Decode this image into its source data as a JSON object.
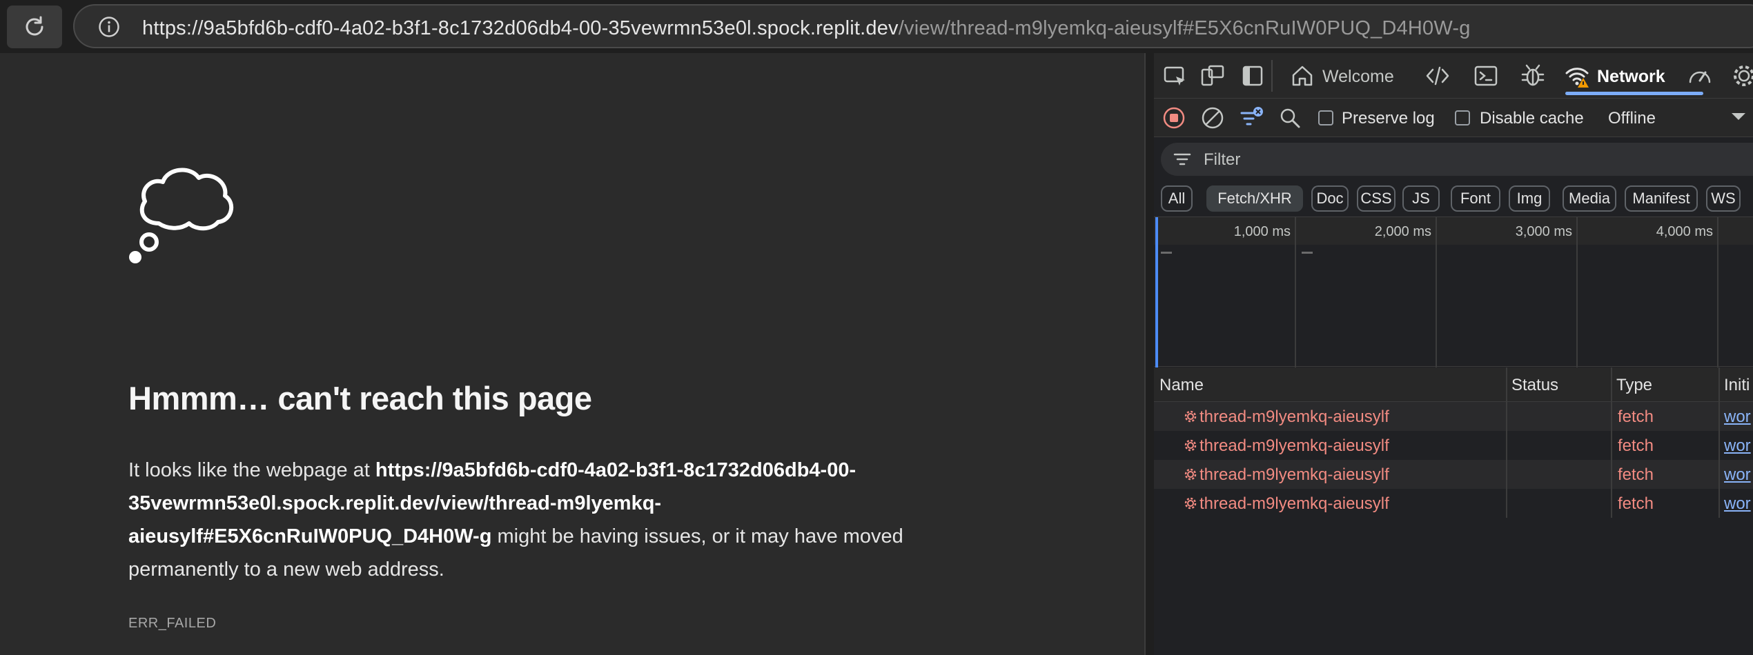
{
  "browser": {
    "url_host": "https://9a5bfd6b-cdf0-4a02-b3f1-8c1732d06db4-00-35vewrmn53e0l.spock.replit.dev",
    "url_path": "/view/thread-m9lyemkq-aieusylf#E5X6cnRuIW0PUQ_D4H0W-g",
    "icons": {
      "reload": "reload-icon",
      "info": "info-icon"
    }
  },
  "error_page": {
    "icon": "thought-cloud-icon",
    "title": "Hmmm… can't reach this page",
    "body_prefix": "It looks like the webpage at ",
    "body_url_line1": "https://9a5bfd6b-cdf0-4a02-b3f1-8c1732d06db4-00-",
    "body_url_line2": "35vewrmn53e0l.spock.replit.dev/view/thread-m9lyemkq-",
    "body_url_line3": "aieusylf#E5X6cnRuIW0PUQ_D4H0W-g",
    "body_suffix_line3": " might be having issues, or it may have moved",
    "body_line4": "permanently to a new web address.",
    "error_code": "ERR_FAILED"
  },
  "devtools": {
    "tabs": {
      "welcome": "Welcome",
      "network": "Network"
    },
    "toolbar": {
      "preserve_log": "Preserve log",
      "disable_cache": "Disable cache",
      "throttling": "Offline"
    },
    "filter": {
      "placeholder": "Filter"
    },
    "type_chips": [
      "All",
      "Fetch/XHR",
      "Doc",
      "CSS",
      "JS",
      "Font",
      "Img",
      "Media",
      "Manifest",
      "WS"
    ],
    "active_chip": "Fetch/XHR",
    "overview_ticks": [
      "1,000 ms",
      "2,000 ms",
      "3,000 ms",
      "4,000 ms"
    ],
    "table": {
      "columns": [
        "Name",
        "Status",
        "Type",
        "Initi"
      ],
      "rows": [
        {
          "name": "thread-m9lyemkq-aieusylf",
          "status": "",
          "type": "fetch",
          "initiator": "wor"
        },
        {
          "name": "thread-m9lyemkq-aieusylf",
          "status": "",
          "type": "fetch",
          "initiator": "wor"
        },
        {
          "name": "thread-m9lyemkq-aieusylf",
          "status": "",
          "type": "fetch",
          "initiator": "wor"
        },
        {
          "name": "thread-m9lyemkq-aieusylf",
          "status": "",
          "type": "fetch",
          "initiator": "wor"
        }
      ]
    },
    "colors": {
      "error_text": "#f28b82",
      "link": "#8ab4f8",
      "active_tab_underline": "#7cacf8"
    }
  }
}
